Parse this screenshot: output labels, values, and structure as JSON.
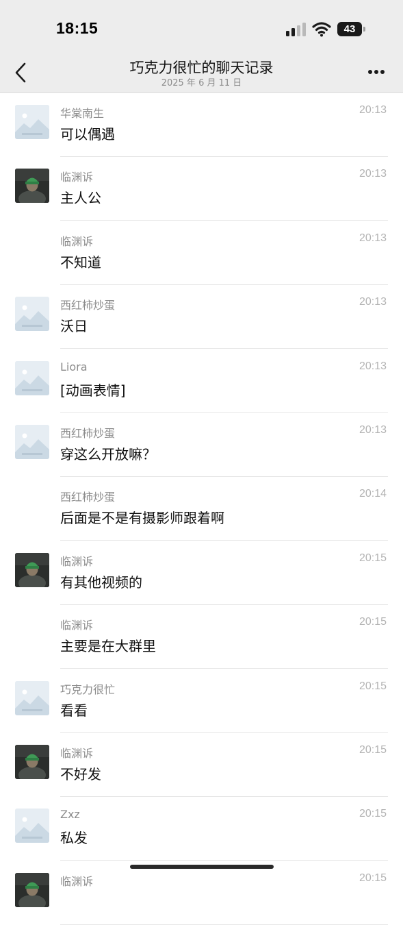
{
  "status_bar": {
    "time": "18:15",
    "battery": "43",
    "signal_bars_active": 2,
    "signal_bars_total": 4
  },
  "header": {
    "title": "巧克力很忙的聊天记录",
    "date": "2025 年 6 月 11 日"
  },
  "icons": {
    "back": "chevron-left-icon",
    "more": "more-horizontal-icon",
    "avatar_placeholder": "image-placeholder-icon"
  },
  "messages": [
    {
      "sender": "华棠南生",
      "text": "可以偶遇",
      "time": "20:13",
      "avatar": "placeholder"
    },
    {
      "sender": "临渊诉",
      "text": "主人公",
      "time": "20:13",
      "avatar": "photo"
    },
    {
      "sender": "临渊诉",
      "text": "不知道",
      "time": "20:13",
      "avatar": "none"
    },
    {
      "sender": "西红柿炒蛋",
      "text": "沃日",
      "time": "20:13",
      "avatar": "placeholder"
    },
    {
      "sender": "Liora",
      "text": "[动画表情]",
      "time": "20:13",
      "avatar": "placeholder"
    },
    {
      "sender": "西红柿炒蛋",
      "text": "穿这么开放嘛？",
      "time": "20:13",
      "avatar": "placeholder"
    },
    {
      "sender": "西红柿炒蛋",
      "text": "后面是不是有摄影师跟着啊",
      "time": "20:14",
      "avatar": "none"
    },
    {
      "sender": "临渊诉",
      "text": "有其他视频的",
      "time": "20:15",
      "avatar": "photo"
    },
    {
      "sender": "临渊诉",
      "text": "主要是在大群里",
      "time": "20:15",
      "avatar": "none"
    },
    {
      "sender": "巧克力很忙",
      "text": "看看",
      "time": "20:15",
      "avatar": "placeholder"
    },
    {
      "sender": "临渊诉",
      "text": "不好发",
      "time": "20:15",
      "avatar": "photo"
    },
    {
      "sender": "Zxz",
      "text": "私发",
      "time": "20:15",
      "avatar": "placeholder"
    },
    {
      "sender": "临渊诉",
      "text": "",
      "time": "20:15",
      "avatar": "photo"
    }
  ]
}
